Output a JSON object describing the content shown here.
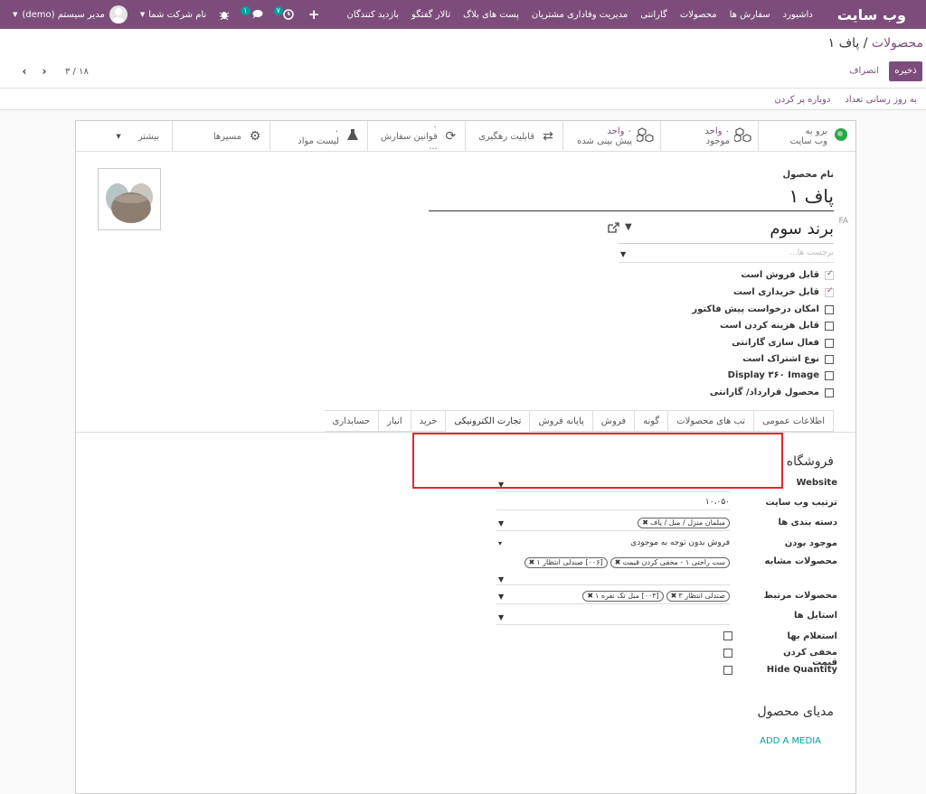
{
  "navbar": {
    "brand": "وب سایت",
    "menu": [
      "داشبورد",
      "سفارش ها",
      "محصولات",
      "گارانتی",
      "مدیریت وفاداری مشتریان",
      "پست های بلاگ",
      "تالار گفتگو",
      "بازدید کنندگان"
    ],
    "activity_badge": "۷",
    "messages_badge": "۱",
    "company": "نام شرکت شما",
    "user": "مدیر سیستم (demo)"
  },
  "breadcrumb": {
    "parent": "محصولات",
    "separator": " / ",
    "current": "پاف ۱"
  },
  "actions": {
    "save": "ذخیره",
    "discard": "انصراف"
  },
  "pager": {
    "value": "۳ / ۱۸"
  },
  "header_buttons": {
    "update_qty": "به روز رسانی تعداد",
    "replenish": "دوباره پر کردن"
  },
  "smart_buttons": [
    {
      "line1": "برو به",
      "line2": "وب سایت",
      "icon": "globe-icon"
    },
    {
      "line1": "۰ واحد",
      "line2": "موجود",
      "icon": "cubes-icon"
    },
    {
      "line1": "۰ واحد",
      "line2": "پیش بینی شده",
      "icon": "cubes-icon"
    },
    {
      "line1": "",
      "line2": "قابلیت رهگیری",
      "icon": "exchange-icon"
    },
    {
      "line1": "۰",
      "line2": "قوانین سفارش ...",
      "icon": "refresh-icon"
    },
    {
      "line1": "۰",
      "line2": "لیست مواد",
      "icon": "flask-icon"
    },
    {
      "line1": "",
      "line2": "مسیرها",
      "icon": "cogs-icon"
    },
    {
      "line1": "",
      "line2": "بیشتر",
      "icon": "caret-down-icon"
    }
  ],
  "product": {
    "name_label": "نام محصول",
    "name": "پاف ۱",
    "lang": "FA",
    "brand": "برند سوم",
    "tags_placeholder": "برچسب ها..."
  },
  "checkboxes": [
    {
      "label": "قابل فروش است",
      "checked": true
    },
    {
      "label": "قابل خریداری است",
      "checked": true
    },
    {
      "label": "امکان درخواست پیش فاکتور",
      "checked": false
    },
    {
      "label": "قابل هزینه کردن است",
      "checked": false
    },
    {
      "label": "فعال سازی گارانتی",
      "checked": false
    },
    {
      "label": "نوع اشتراک است",
      "checked": false
    },
    {
      "label": "Display ۳۶۰ Image",
      "checked": false
    },
    {
      "label": "محصول قرارداد/ گارانتی",
      "checked": false
    }
  ],
  "tabs": [
    "اطلاعات عمومی",
    "تب های محصولات",
    "گونه",
    "فروش",
    "پایانه فروش",
    "تجارت الکترونیکی",
    "خرید",
    "انبار",
    "حسابداری"
  ],
  "active_tab": "تجارت الکترونیکی",
  "shop": {
    "title": "فروشگاه",
    "website_label": "Website",
    "sequence_label": "ترتیب وب سایت",
    "sequence_value": "۱۰،۰۵۰",
    "category_label": "دسته بندی ها",
    "category_tag": "مبلمان منزل / مبل / پاف",
    "availability_label": "موجود بودن",
    "availability_value": "فروش بدون توجه به موجودی",
    "alternative_label": "محصولات مشابه",
    "alternative_tags": [
      "ست راحتی ۱ - مخفی کردن قیمت",
      "[۰۰۶] صندلی انتظار ۱"
    ],
    "accessory_label": "محصولات مرتبط",
    "accessory_tags": [
      "صندلی انتظار ۳",
      "[۰۰۳] مبل تک نفره ۱"
    ],
    "styles_label": "استایل ها",
    "inquiry_label": "استعلام بها",
    "hide_price_label": "مخفی کردن قیمت",
    "hide_qty_label": "Hide Quantity"
  },
  "media": {
    "title": "مدیای محصول",
    "add": "ADD A MEDIA"
  }
}
